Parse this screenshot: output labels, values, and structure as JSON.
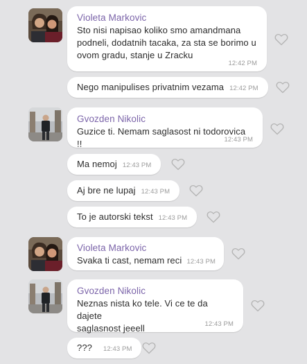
{
  "senders": {
    "violeta": "Violeta Markovic",
    "gvozden": "Gvozden Nikolic"
  },
  "messages": [
    {
      "sender": "Violeta Markovic",
      "lines": [
        "Sto nisi napisao koliko smo amandmana",
        "podneli, dodatnih tacaka, za sta se borimo u",
        "ovom gradu, stanje u Zracku"
      ],
      "time": "12:42 PM"
    },
    {
      "text": "Nego manipulises privatnim vezama",
      "time": "12:42 PM"
    },
    {
      "sender": "Gvozden Nikolic",
      "lines": [
        "Guzice ti. Nemam saglasost ni todorovica !!"
      ],
      "time": "12:43 PM"
    },
    {
      "text": "Ma nemoj",
      "time": "12:43 PM"
    },
    {
      "text": "Aj bre ne lupaj",
      "time": "12:43 PM"
    },
    {
      "text": "To je autorski tekst",
      "time": "12:43 PM"
    },
    {
      "sender": "Violeta Markovic",
      "lines": [
        "Svaka ti cast, nemam reci"
      ],
      "time": "12:43 PM"
    },
    {
      "sender": "Gvozden Nikolic",
      "lines": [
        "Neznas nista ko tele. Vi ce te da dajete",
        "saglasnost jeeell"
      ],
      "time": "12:43 PM"
    },
    {
      "text": "???",
      "time": "12:43 PM"
    }
  ],
  "colors": {
    "background": "#e3e3e5",
    "sender_name": "#7b64a9",
    "timestamp": "#9b9b9b",
    "like_icon": "#b5b5b5"
  },
  "icons": {
    "like": "heart-outline-icon",
    "avatar_violeta": "two-people-photo",
    "avatar_gvozden": "man-standing-photo"
  }
}
